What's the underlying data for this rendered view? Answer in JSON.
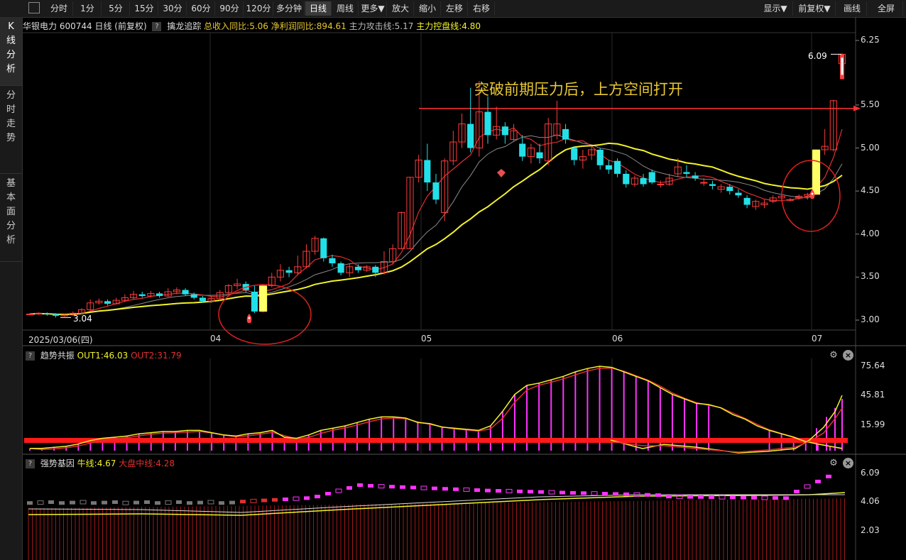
{
  "toolbar": {
    "buttons": [
      "分时",
      "1分",
      "5分",
      "15分",
      "30分",
      "60分",
      "90分",
      "120分",
      "多分钟",
      "日线",
      "周线",
      "更多▼",
      "放大",
      "缩小",
      "左移",
      "右移"
    ],
    "active": "日线",
    "right_buttons": [
      "显示▼",
      "前复权▼",
      "画线",
      "全屏"
    ]
  },
  "leftnav": [
    {
      "label": "K\n线\n分\n析",
      "active": true
    },
    {
      "label": "分\n时\n走\n势",
      "active": false
    },
    {
      "label": "基\n本\n面\n分\n析",
      "active": false
    }
  ],
  "main_header": {
    "stock": "华银电力 600744 日线",
    "adjust": "(前复权)",
    "help": "?",
    "indicator": "擒龙追踪",
    "revenue": "总收入同比:5.06",
    "profit": "净利润同比:894.61",
    "attack": "主力攻击线:5.17",
    "control": "主力控盘线:4.80"
  },
  "annotation": "突破前期压力后，上方空间打开",
  "price_high": "6.09",
  "price_low": "3.04",
  "price_axis": [
    "6.25",
    "5.50",
    "5.00",
    "4.50",
    "4.00",
    "3.50",
    "3.00"
  ],
  "date_axis": [
    "2025/03/06(四)",
    "04",
    "05",
    "06",
    "07"
  ],
  "panel2_header": {
    "name": "趋势共振",
    "out1": "OUT1:46.03",
    "out2": "OUT2:31.79",
    "help": "?"
  },
  "panel2_axis": [
    "75.64",
    "45.81",
    "15.99"
  ],
  "panel3_header": {
    "name": "强势基因",
    "bull": "牛线:4.67",
    "market": "大盘中线:4.28",
    "help": "?"
  },
  "panel3_axis": [
    "6.09",
    "4.06",
    "2.03"
  ],
  "colors": {
    "up": "#ff3b3b",
    "down": "#22e0e8",
    "ma_yellow": "#f2f22a",
    "ma_red": "#e03030",
    "magenta": "#ff33ff",
    "annotation": "#e8c832"
  },
  "chart_data": {
    "type": "candlestick",
    "ylim": [
      2.9,
      6.35
    ],
    "candles": [
      [
        3.07,
        3.07,
        3.08,
        3.06
      ],
      [
        3.07,
        3.08,
        3.09,
        3.06
      ],
      [
        3.08,
        3.07,
        3.09,
        3.05
      ],
      [
        3.07,
        3.05,
        3.08,
        3.03
      ],
      [
        3.05,
        3.06,
        3.07,
        3.04
      ],
      [
        3.06,
        3.08,
        3.1,
        3.05
      ],
      [
        3.08,
        3.12,
        3.14,
        3.07
      ],
      [
        3.12,
        3.2,
        3.24,
        3.1
      ],
      [
        3.2,
        3.22,
        3.25,
        3.18
      ],
      [
        3.22,
        3.19,
        3.24,
        3.17
      ],
      [
        3.19,
        3.23,
        3.26,
        3.18
      ],
      [
        3.23,
        3.26,
        3.3,
        3.21
      ],
      [
        3.26,
        3.3,
        3.34,
        3.24
      ],
      [
        3.3,
        3.28,
        3.33,
        3.26
      ],
      [
        3.28,
        3.31,
        3.34,
        3.26
      ],
      [
        3.31,
        3.28,
        3.33,
        3.26
      ],
      [
        3.28,
        3.33,
        3.37,
        3.27
      ],
      [
        3.33,
        3.35,
        3.38,
        3.3
      ],
      [
        3.35,
        3.3,
        3.37,
        3.28
      ],
      [
        3.3,
        3.26,
        3.32,
        3.24
      ],
      [
        3.26,
        3.22,
        3.28,
        3.2
      ],
      [
        3.22,
        3.25,
        3.28,
        3.2
      ],
      [
        3.25,
        3.32,
        3.35,
        3.23
      ],
      [
        3.32,
        3.4,
        3.42,
        3.3
      ],
      [
        3.4,
        3.42,
        3.48,
        3.36
      ],
      [
        3.42,
        3.35,
        3.45,
        3.32
      ],
      [
        3.33,
        3.1,
        3.4,
        3.08
      ],
      [
        3.1,
        3.4,
        3.42,
        3.09
      ],
      [
        3.4,
        3.5,
        3.55,
        3.38
      ],
      [
        3.5,
        3.58,
        3.65,
        3.45
      ],
      [
        3.58,
        3.55,
        3.62,
        3.5
      ],
      [
        3.55,
        3.62,
        3.75,
        3.52
      ],
      [
        3.62,
        3.8,
        3.88,
        3.6
      ],
      [
        3.8,
        3.95,
        3.98,
        3.76
      ],
      [
        3.95,
        3.72,
        3.96,
        3.68
      ],
      [
        3.72,
        3.66,
        3.76,
        3.62
      ],
      [
        3.66,
        3.55,
        3.68,
        3.52
      ],
      [
        3.55,
        3.62,
        3.66,
        3.5
      ],
      [
        3.62,
        3.58,
        3.65,
        3.55
      ],
      [
        3.58,
        3.62,
        3.64,
        3.56
      ],
      [
        3.62,
        3.55,
        3.64,
        3.5
      ],
      [
        3.55,
        3.68,
        3.8,
        3.53
      ],
      [
        3.68,
        3.83,
        3.88,
        3.65
      ],
      [
        3.83,
        4.25,
        4.26,
        3.83
      ],
      [
        3.83,
        4.66,
        4.66,
        3.83
      ],
      [
        4.66,
        4.86,
        4.92,
        4.6
      ],
      [
        4.86,
        4.6,
        5.05,
        4.5
      ],
      [
        4.6,
        4.4,
        4.7,
        4.35
      ],
      [
        4.25,
        4.85,
        4.88,
        4.15
      ],
      [
        4.85,
        5.07,
        5.2,
        4.8
      ],
      [
        5.07,
        5.28,
        5.4,
        5.0
      ],
      [
        5.28,
        5.0,
        5.7,
        4.95
      ],
      [
        5.0,
        5.42,
        5.78,
        4.9
      ],
      [
        5.42,
        5.15,
        5.6,
        5.05
      ],
      [
        5.15,
        5.25,
        5.48,
        5.1
      ],
      [
        5.25,
        5.15,
        5.3,
        5.05
      ],
      [
        5.1,
        5.2,
        5.28,
        5.08
      ],
      [
        5.05,
        4.9,
        5.15,
        4.85
      ],
      [
        4.9,
        5.0,
        5.05,
        4.82
      ],
      [
        4.95,
        4.88,
        5.05,
        4.82
      ],
      [
        4.85,
        5.28,
        5.35,
        4.8
      ],
      [
        5.15,
        5.28,
        5.55,
        5.1
      ],
      [
        5.22,
        5.1,
        5.28,
        5.05
      ],
      [
        5.0,
        4.86,
        5.02,
        4.8
      ],
      [
        4.86,
        4.9,
        4.98,
        4.76
      ],
      [
        4.92,
        4.98,
        5.02,
        4.86
      ],
      [
        4.98,
        4.8,
        5.0,
        4.75
      ],
      [
        4.8,
        4.75,
        4.86,
        4.7
      ],
      [
        4.85,
        4.7,
        4.88,
        4.66
      ],
      [
        4.7,
        4.58,
        4.74,
        4.54
      ],
      [
        4.58,
        4.65,
        4.68,
        4.55
      ],
      [
        4.65,
        4.58,
        4.7,
        4.55
      ],
      [
        4.72,
        4.6,
        4.75,
        4.58
      ],
      [
        4.58,
        4.58,
        4.62,
        4.54
      ],
      [
        4.58,
        4.65,
        4.7,
        4.56
      ],
      [
        4.7,
        4.78,
        4.88,
        4.66
      ],
      [
        4.72,
        4.7,
        4.8,
        4.66
      ],
      [
        4.68,
        4.65,
        4.72,
        4.62
      ],
      [
        4.6,
        4.6,
        4.65,
        4.56
      ],
      [
        4.58,
        4.56,
        4.62,
        4.52
      ],
      [
        4.52,
        4.55,
        4.58,
        4.48
      ],
      [
        4.55,
        4.5,
        4.58,
        4.46
      ],
      [
        4.48,
        4.45,
        4.52,
        4.42
      ],
      [
        4.42,
        4.34,
        4.45,
        4.3
      ],
      [
        4.32,
        4.38,
        4.4,
        4.28
      ],
      [
        4.34,
        4.36,
        4.4,
        4.3
      ],
      [
        4.38,
        4.42,
        4.45,
        4.36
      ],
      [
        4.42,
        4.44,
        4.46,
        4.38
      ],
      [
        4.4,
        4.4,
        4.42,
        4.38
      ],
      [
        4.42,
        4.44,
        4.46,
        4.4
      ],
      [
        4.44,
        4.46,
        4.48,
        4.4
      ],
      [
        4.46,
        4.98,
        4.98,
        4.46
      ],
      [
        4.98,
        5.02,
        5.22,
        4.92
      ],
      [
        4.98,
        5.55,
        5.56,
        4.96
      ],
      [
        5.98,
        6.09,
        6.1,
        5.8
      ]
    ]
  }
}
